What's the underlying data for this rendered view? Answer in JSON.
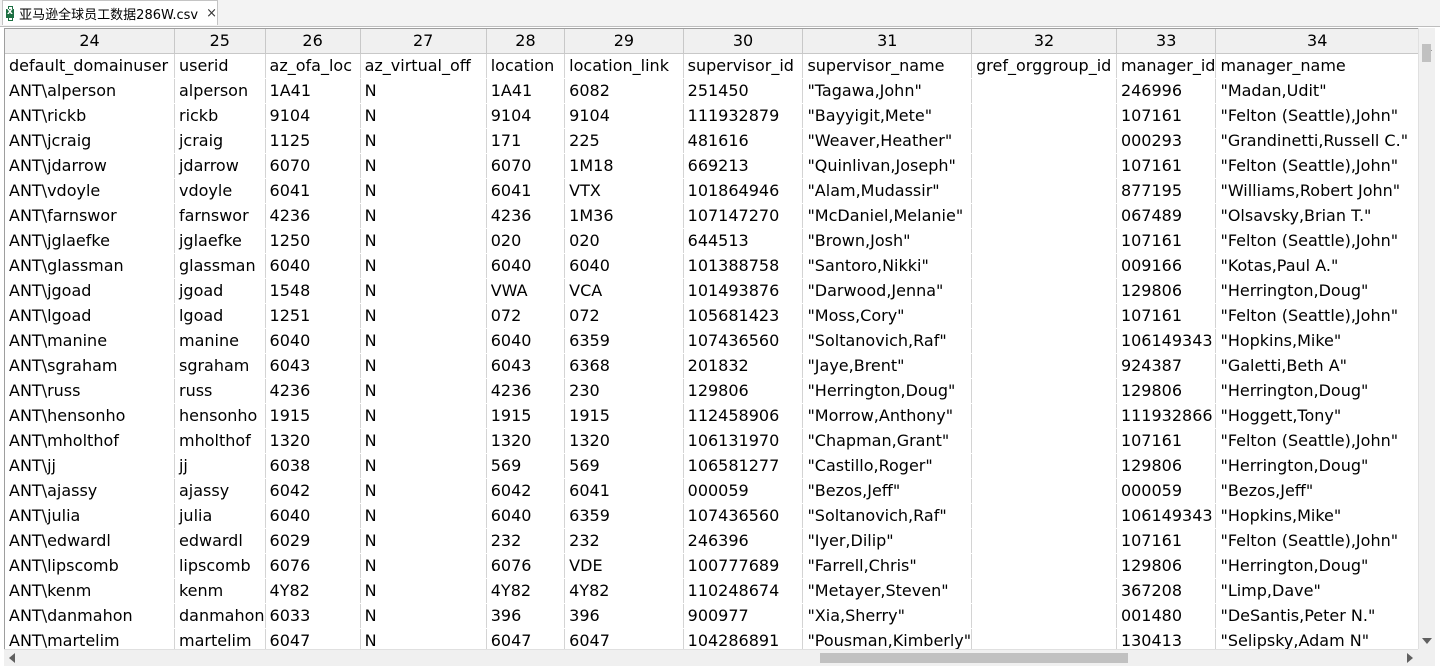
{
  "tab": {
    "title": "亚马逊全球员工数据286W.csv",
    "close_glyph": "×",
    "icon": "excel-file-icon"
  },
  "grid": {
    "column_numbers": [
      "24",
      "25",
      "26",
      "27",
      "28",
      "29",
      "30",
      "31",
      "32",
      "33",
      "34"
    ],
    "rows": [
      [
        "default_domainuser",
        "userid",
        "az_ofa_loc",
        "az_virtual_off",
        "location",
        "location_link",
        "supervisor_id",
        "supervisor_name",
        "gref_orggroup_id",
        "manager_id",
        "manager_name"
      ],
      [
        "ANT\\alperson",
        "alperson",
        "1A41",
        "N",
        "1A41",
        "6082",
        "251450",
        "\"Tagawa,John\"",
        "",
        "246996",
        "\"Madan,Udit\""
      ],
      [
        "ANT\\rickb",
        "rickb",
        "9104",
        "N",
        "9104",
        "9104",
        "111932879",
        "\"Bayyigit,Mete\"",
        "",
        "107161",
        "\"Felton (Seattle),John\""
      ],
      [
        "ANT\\jcraig",
        "jcraig",
        "1125",
        "N",
        "171",
        "225",
        "481616",
        "\"Weaver,Heather\"",
        "",
        "000293",
        "\"Grandinetti,Russell C.\""
      ],
      [
        "ANT\\jdarrow",
        "jdarrow",
        "6070",
        "N",
        "6070",
        "1M18",
        "669213",
        "\"Quinlivan,Joseph\"",
        "",
        "107161",
        "\"Felton (Seattle),John\""
      ],
      [
        "ANT\\vdoyle",
        "vdoyle",
        "6041",
        "N",
        "6041",
        "VTX",
        "101864946",
        "\"Alam,Mudassir\"",
        "",
        "877195",
        "\"Williams,Robert John\""
      ],
      [
        "ANT\\farnswor",
        "farnswor",
        "4236",
        "N",
        "4236",
        "1M36",
        "107147270",
        "\"McDaniel,Melanie\"",
        "",
        "067489",
        "\"Olsavsky,Brian T.\""
      ],
      [
        "ANT\\jglaefke",
        "jglaefke",
        "1250",
        "N",
        "020",
        "020",
        "644513",
        "\"Brown,Josh\"",
        "",
        "107161",
        "\"Felton (Seattle),John\""
      ],
      [
        "ANT\\glassman",
        "glassman",
        "6040",
        "N",
        "6040",
        "6040",
        "101388758",
        "\"Santoro,Nikki\"",
        "",
        "009166",
        "\"Kotas,Paul A.\""
      ],
      [
        "ANT\\jgoad",
        "jgoad",
        "1548",
        "N",
        "VWA",
        "VCA",
        "101493876",
        "\"Darwood,Jenna\"",
        "",
        "129806",
        "\"Herrington,Doug\""
      ],
      [
        "ANT\\lgoad",
        "lgoad",
        "1251",
        "N",
        "072",
        "072",
        "105681423",
        "\"Moss,Cory\"",
        "",
        "107161",
        "\"Felton (Seattle),John\""
      ],
      [
        "ANT\\manine",
        "manine",
        "6040",
        "N",
        "6040",
        "6359",
        "107436560",
        "\"Soltanovich,Raf\"",
        "",
        "106149343",
        "\"Hopkins,Mike\""
      ],
      [
        "ANT\\sgraham",
        "sgraham",
        "6043",
        "N",
        "6043",
        "6368",
        "201832",
        "\"Jaye,Brent\"",
        "",
        "924387",
        "\"Galetti,Beth A\""
      ],
      [
        "ANT\\russ",
        "russ",
        "4236",
        "N",
        "4236",
        "230",
        "129806",
        "\"Herrington,Doug\"",
        "",
        "129806",
        "\"Herrington,Doug\""
      ],
      [
        "ANT\\hensonho",
        "hensonho",
        "1915",
        "N",
        "1915",
        "1915",
        "112458906",
        "\"Morrow,Anthony\"",
        "",
        "111932866",
        "\"Hoggett,Tony\""
      ],
      [
        "ANT\\mholthof",
        "mholthof",
        "1320",
        "N",
        "1320",
        "1320",
        "106131970",
        "\"Chapman,Grant\"",
        "",
        "107161",
        "\"Felton (Seattle),John\""
      ],
      [
        "ANT\\jj",
        "jj",
        "6038",
        "N",
        "569",
        "569",
        "106581277",
        "\"Castillo,Roger\"",
        "",
        "129806",
        "\"Herrington,Doug\""
      ],
      [
        "ANT\\ajassy",
        "ajassy",
        "6042",
        "N",
        "6042",
        "6041",
        "000059",
        "\"Bezos,Jeff\"",
        "",
        "000059",
        "\"Bezos,Jeff\""
      ],
      [
        "ANT\\julia",
        "julia",
        "6040",
        "N",
        "6040",
        "6359",
        "107436560",
        "\"Soltanovich,Raf\"",
        "",
        "106149343",
        "\"Hopkins,Mike\""
      ],
      [
        "ANT\\edwardl",
        "edwardl",
        "6029",
        "N",
        "232",
        "232",
        "246396",
        "\"Iyer,Dilip\"",
        "",
        "107161",
        "\"Felton (Seattle),John\""
      ],
      [
        "ANT\\lipscomb",
        "lipscomb",
        "6076",
        "N",
        "6076",
        "VDE",
        "100777689",
        "\"Farrell,Chris\"",
        "",
        "129806",
        "\"Herrington,Doug\""
      ],
      [
        "ANT\\kenm",
        "kenm",
        "4Y82",
        "N",
        "4Y82",
        "4Y82",
        "110248674",
        "\"Metayer,Steven\"",
        "",
        "367208",
        "\"Limp,Dave\""
      ],
      [
        "ANT\\danmahon",
        "danmahon",
        "6033",
        "N",
        "396",
        "396",
        "900977",
        "\"Xia,Sherry\"",
        "",
        "001480",
        "\"DeSantis,Peter N.\""
      ],
      [
        "ANT\\martelim",
        "martelim",
        "6047",
        "N",
        "6047",
        "6047",
        "104286891",
        "\"Pousman,Kimberly\"",
        "",
        "130413",
        "\"Selipsky,Adam N\""
      ]
    ]
  }
}
